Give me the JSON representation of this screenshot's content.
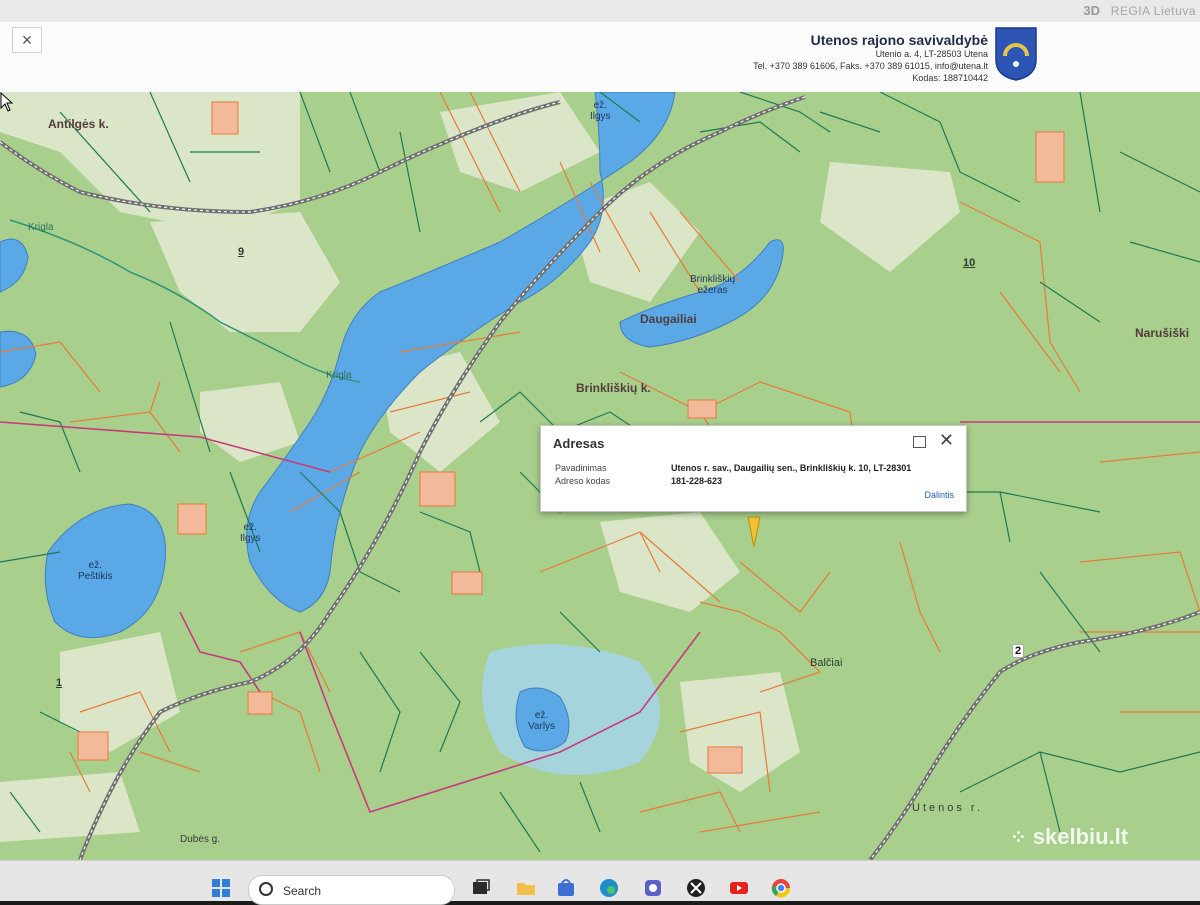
{
  "topbar": {
    "mode_label": "3D",
    "regia_label": "REGIA Lietuva"
  },
  "header": {
    "close_label": "×",
    "municipality_name": "Utenos rajono savivaldybė",
    "address_line": "Utenio a. 4, LT-28503 Utena",
    "contacts_line": "Tel. +370 389 61606, Faks. +370 389 61015, info@utena.lt",
    "code_line": "Kodas: 188710442"
  },
  "map": {
    "labels": {
      "antilges": "Antilgės k.",
      "ilgys_top": "ež.\nIlgys",
      "ilgys_mid": "ež.\nIlgys",
      "pestikis": "ež.\nPeštikis",
      "varlys": "ež.\nVarlys",
      "brinkliskiu_ezeras": "Brinkliškių\nežeras",
      "daugailiai": "Daugailiai",
      "brinkliskiu_k": "Brinkliškių k.",
      "narusiski": "Narušiški",
      "balciai": "Balčiai",
      "utenos_r": "Utenos r.",
      "krisla": "Krigla",
      "krisla_river": "Krigla",
      "dubes": "Dubės g.",
      "num_9": "9",
      "num_10": "10",
      "num_1": "1",
      "road_2": "2"
    },
    "colors": {
      "forest": "#a9cf8d",
      "field": "#dbe6c8",
      "water": "#5aa9e6",
      "parcel_orange": "#e77b3a",
      "parcel_green": "#1e7a52",
      "boundary_pink": "#c93a7c",
      "rail": "#707070",
      "marker": "#f1c232"
    }
  },
  "popup": {
    "title": "Adresas",
    "maximize_icon": "window-icon",
    "close_icon": "close-icon",
    "name_label": "Pavadinimas",
    "name_value": "Utenos r. sav., Daugailių sen., Brinkliškių k. 10, LT-28301",
    "code_label": "Adreso kodas",
    "code_value": "181-228-623",
    "share_label": "Dalintis"
  },
  "watermark": {
    "text": "skelbiu.lt"
  },
  "taskbar": {
    "search_placeholder": "Search",
    "icons": [
      "windows-start-icon",
      "task-view-icon",
      "file-explorer-icon",
      "store-icon",
      "edge-icon",
      "teams-icon",
      "xbox-icon",
      "youtube-icon",
      "chrome-icon"
    ]
  }
}
